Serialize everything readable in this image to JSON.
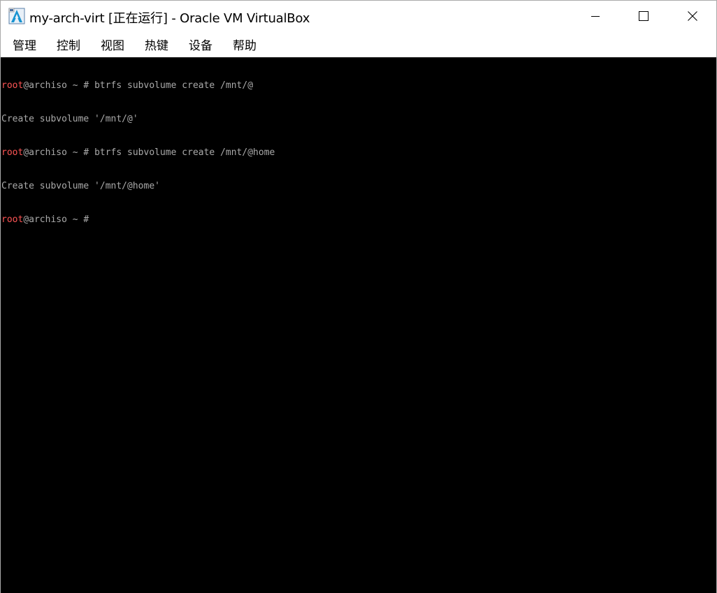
{
  "window": {
    "title": "my-arch-virt [正在运行] - Oracle VM VirtualBox",
    "icon": "virtualbox-arch-icon",
    "controls": {
      "minimize_icon": "minimize-icon",
      "maximize_icon": "maximize-icon",
      "close_icon": "close-icon"
    }
  },
  "menu": {
    "items": [
      "管理",
      "控制",
      "视图",
      "热键",
      "设备",
      "帮助"
    ]
  },
  "console": {
    "colors": {
      "background": "#000000",
      "text": "#aaaaaa",
      "user": "#ff5555"
    },
    "lines": [
      {
        "type": "prompt",
        "user": "root",
        "host_rest": "@archiso ~ # ",
        "command": "btrfs subvolume create /mnt/@"
      },
      {
        "type": "output",
        "text": "Create subvolume '/mnt/@'"
      },
      {
        "type": "prompt",
        "user": "root",
        "host_rest": "@archiso ~ # ",
        "command": "btrfs subvolume create /mnt/@home"
      },
      {
        "type": "output",
        "text": "Create subvolume '/mnt/@home'"
      },
      {
        "type": "prompt",
        "user": "root",
        "host_rest": "@archiso ~ # ",
        "command": ""
      }
    ]
  }
}
